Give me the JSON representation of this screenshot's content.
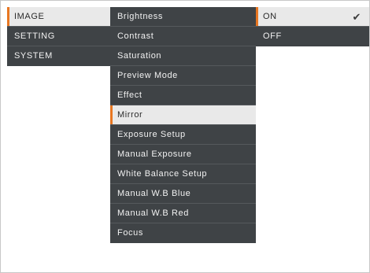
{
  "main_menu": {
    "items": [
      "IMAGE",
      "SETTING",
      "SYSTEM"
    ],
    "selected_index": 0
  },
  "image_submenu": {
    "items": [
      "Brightness",
      "Contrast",
      "Saturation",
      "Preview Mode",
      "Effect",
      "Mirror",
      "Exposure Setup",
      "Manual Exposure",
      "White Balance Setup",
      "Manual W.B Blue",
      "Manual W.B Red",
      "Focus"
    ],
    "selected_index": 5
  },
  "mirror_options": {
    "items": [
      "ON",
      "OFF"
    ],
    "selected_index": 0,
    "checked_icon": "checkmark-icon"
  },
  "colors": {
    "menu_bg": "#3f4346",
    "menu_text": "#f2f2f2",
    "selected_bg": "#e9e9e9",
    "accent": "#e87722"
  }
}
